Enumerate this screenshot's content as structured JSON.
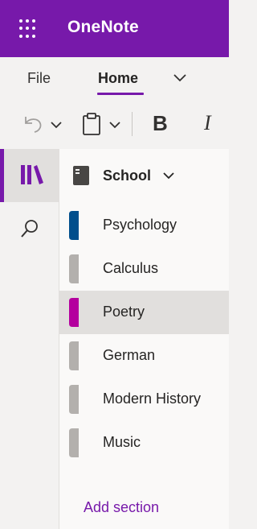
{
  "app": {
    "title": "OneNote",
    "accent": "#7719aa"
  },
  "ribbon": {
    "tabs": {
      "file": "File",
      "home": "Home"
    },
    "toolbar": {
      "bold": "B",
      "italic": "I"
    }
  },
  "notebook": {
    "name": "School",
    "sections": [
      {
        "label": "Psychology",
        "color": "#004e8c",
        "selected": false
      },
      {
        "label": "Calculus",
        "color": "#b3b0ad",
        "selected": false
      },
      {
        "label": "Poetry",
        "color": "#b4009e",
        "selected": true
      },
      {
        "label": "German",
        "color": "#b3b0ad",
        "selected": false
      },
      {
        "label": "Modern History",
        "color": "#b3b0ad",
        "selected": false
      },
      {
        "label": "Music",
        "color": "#b3b0ad",
        "selected": false
      }
    ],
    "add_section": "Add section"
  }
}
